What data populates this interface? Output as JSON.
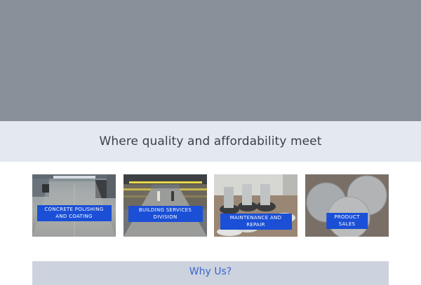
{
  "hero": {
    "background": "#8a9099"
  },
  "tagline": {
    "text": "Where quality and affordability meet"
  },
  "services": [
    {
      "label": "CONCRETE POLISHING AND COATING"
    },
    {
      "label": "BUILDING SERVICES DIVISION"
    },
    {
      "label": "MAINTENANCE AND REPAIR"
    },
    {
      "label": "PRODUCT SALES"
    }
  ],
  "why_us": {
    "title": "Why Us?"
  },
  "colors": {
    "accent": "#1a4fd6",
    "link": "#3b63c9",
    "tagline_band": "#e4e8ef",
    "why_band": "#ccd3df"
  }
}
